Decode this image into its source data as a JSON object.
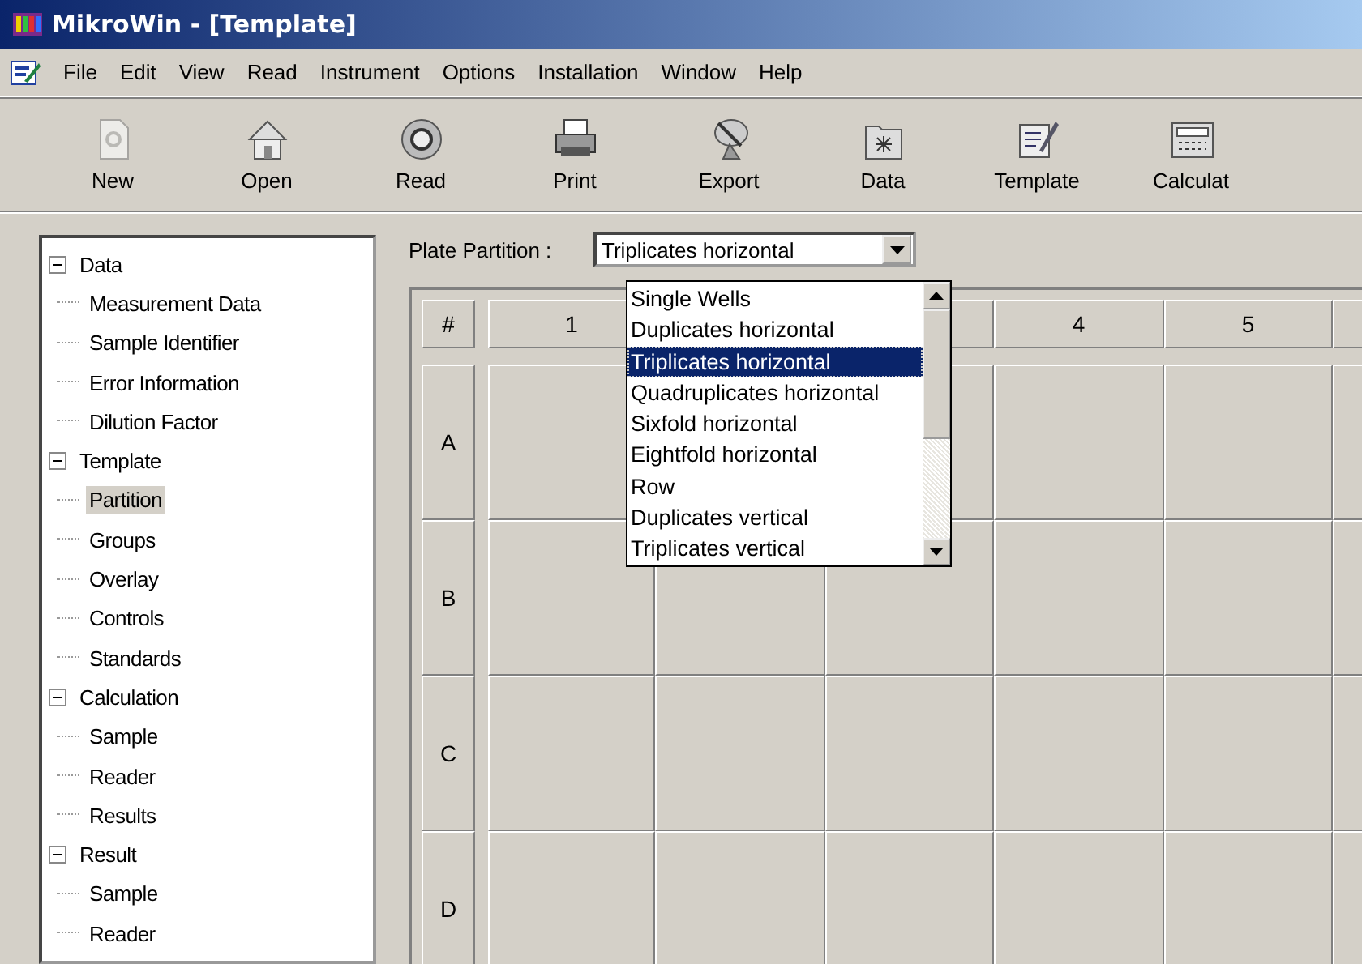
{
  "window": {
    "title": "MikroWin - [Template]"
  },
  "menu": [
    "File",
    "Edit",
    "View",
    "Read",
    "Instrument",
    "Options",
    "Installation",
    "Window",
    "Help"
  ],
  "toolbar": [
    {
      "label": "New",
      "disabled": true
    },
    {
      "label": "Open",
      "disabled": false
    },
    {
      "label": "Read",
      "disabled": false
    },
    {
      "label": "Print",
      "disabled": false
    },
    {
      "label": "Export",
      "disabled": false
    },
    {
      "label": "Data",
      "disabled": false
    },
    {
      "label": "Template",
      "disabled": false
    },
    {
      "label": "Calculat",
      "disabled": false
    }
  ],
  "tree": [
    {
      "label": "Data",
      "expanded": true,
      "selected": false,
      "children": [
        {
          "label": "Measurement Data",
          "selected": false
        },
        {
          "label": "Sample Identifier",
          "selected": false
        },
        {
          "label": "Error Information",
          "selected": false
        },
        {
          "label": "Dilution Factor",
          "selected": false
        }
      ]
    },
    {
      "label": "Template",
      "expanded": true,
      "selected": false,
      "children": [
        {
          "label": "Partition",
          "selected": true
        },
        {
          "label": "Groups",
          "selected": false
        },
        {
          "label": "Overlay",
          "selected": false
        },
        {
          "label": "Controls",
          "selected": false
        },
        {
          "label": "Standards",
          "selected": false
        }
      ]
    },
    {
      "label": "Calculation",
      "expanded": true,
      "selected": false,
      "children": [
        {
          "label": "Sample",
          "selected": false
        },
        {
          "label": "Reader",
          "selected": false
        },
        {
          "label": "Results",
          "selected": false
        }
      ]
    },
    {
      "label": "Result",
      "expanded": true,
      "selected": false,
      "children": [
        {
          "label": "Sample",
          "selected": false
        },
        {
          "label": "Reader",
          "selected": false
        }
      ]
    }
  ],
  "partition": {
    "label": "Plate Partition :",
    "value": "Triplicates horizontal",
    "expanded": true,
    "options": [
      {
        "label": "Single Wells",
        "selected": false
      },
      {
        "label": "Duplicates horizontal",
        "selected": false
      },
      {
        "label": "Triplicates horizontal",
        "selected": true
      },
      {
        "label": "Quadruplicates horizontal",
        "selected": false
      },
      {
        "label": "Sixfold horizontal",
        "selected": false
      },
      {
        "label": "Eightfold horizontal",
        "selected": false
      },
      {
        "label": "Row",
        "selected": false
      },
      {
        "label": "Duplicates vertical",
        "selected": false
      },
      {
        "label": "Triplicates vertical",
        "selected": false
      }
    ]
  },
  "plate": {
    "corner": "#",
    "column_headers": [
      "1",
      "4",
      "5"
    ],
    "rows": [
      "A",
      "B",
      "C",
      "D"
    ]
  }
}
